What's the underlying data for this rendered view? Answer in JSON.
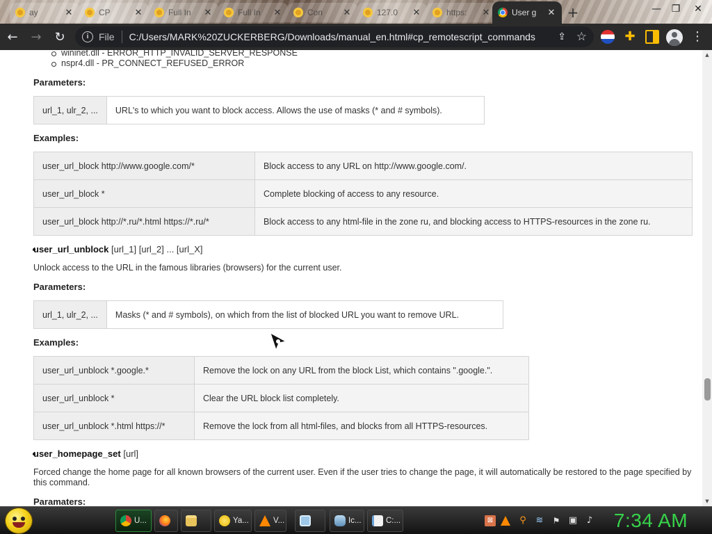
{
  "browser": {
    "tabs": [
      {
        "title": "ay",
        "icon": "gm-icon"
      },
      {
        "title": "CP",
        "icon": "gm-icon"
      },
      {
        "title": "Full In",
        "icon": "gm-icon"
      },
      {
        "title": "Full In",
        "icon": "gm-icon"
      },
      {
        "title": "Con",
        "icon": "gm-icon"
      },
      {
        "title": "127.0",
        "icon": "gm-icon"
      },
      {
        "title": "https:",
        "icon": "gm-icon"
      },
      {
        "title": "User g",
        "icon": "chrome-icon",
        "active": true
      }
    ],
    "new_tab": "+",
    "window_controls": {
      "minimize": "—",
      "maximize": "❐",
      "close": "✕"
    },
    "nav": {
      "back": "←",
      "forward": "→",
      "reload": "↻"
    },
    "omnibox": {
      "scheme_label": "File",
      "url": "C:/Users/MARK%20ZUCKERBERG/Downloads/manual_en.html#cp_remotescript_commands"
    },
    "menu": "⋮"
  },
  "page": {
    "error_list": [
      "wininet.dll - ERROR_HTTP_INVALID_SERVER_RESPONSE",
      "nspr4.dll - PR_CONNECT_REFUSED_ERROR"
    ],
    "params_label_1": "Parameters:",
    "params_table_1": [
      [
        "url_1, ulr_2, ...",
        "URL's to which you want to block access. Allows the use of masks (* and # symbols)."
      ]
    ],
    "examples_label_1": "Examples:",
    "examples_table_1": [
      [
        "user_url_block http://www.google.com/*",
        "Block access to any URL on http://www.google.com/."
      ],
      [
        "user_url_block *",
        "Complete blocking of access to any resource."
      ],
      [
        "user_url_block http://*.ru/*.html https://*.ru/*",
        "Block access to any html-file in the zone ru, and blocking access to HTTPS-resources in the zone ru."
      ]
    ],
    "cmd_unblock": {
      "name": "user_url_unblock",
      "args": " [url_1] [url_2] ... [url_X]"
    },
    "unblock_desc": "Unlock access to the URL in the famous libraries (browsers) for the current user.",
    "params_label_2": "Parameters:",
    "params_table_2": [
      [
        "url_1, ulr_2, ...",
        "Masks (* and # symbols), on which from the list of blocked URL you want to remove URL."
      ]
    ],
    "examples_label_2": "Examples:",
    "examples_table_2": [
      [
        "user_url_unblock *.google.*",
        "Remove the lock on any URL from the block List, which contains \".google.\"."
      ],
      [
        "user_url_unblock *",
        "Clear the URL block list completely."
      ],
      [
        "user_url_unblock *.html https://*",
        "Remove the lock from all html-files, and blocks from all HTTPS-resources."
      ]
    ],
    "cmd_homepage": {
      "name": "user_homepage_set",
      "args": " [url]"
    },
    "homepage_desc": "Forced change the home page for all known browsers of the current user. Even if the user tries to change the page, it will automatically be restored to the page specified by this command.",
    "params_label_3": "Paramaters:"
  },
  "taskbar": {
    "items": [
      {
        "label": "U...",
        "icon": "chrome-icon",
        "active": true
      },
      {
        "label": "",
        "icon": "firefox-icon"
      },
      {
        "label": "",
        "icon": "folder-icon"
      },
      {
        "label": "Ya...",
        "icon": "messenger-icon"
      },
      {
        "label": "V...",
        "icon": "vlc-icon"
      },
      {
        "label": "",
        "icon": "notepad-icon"
      },
      {
        "label": "Ic...",
        "icon": "app-icon"
      },
      {
        "label": "C:...",
        "icon": "notepad-icon"
      }
    ],
    "clock": "7:34 AM"
  },
  "colors": {
    "tab_active": "#2b2b2b",
    "toolbar": "#2b2b2b",
    "table_cell": "#f4f4f4",
    "clock": "#37d24a",
    "taskbar_active": "#1c4424"
  }
}
